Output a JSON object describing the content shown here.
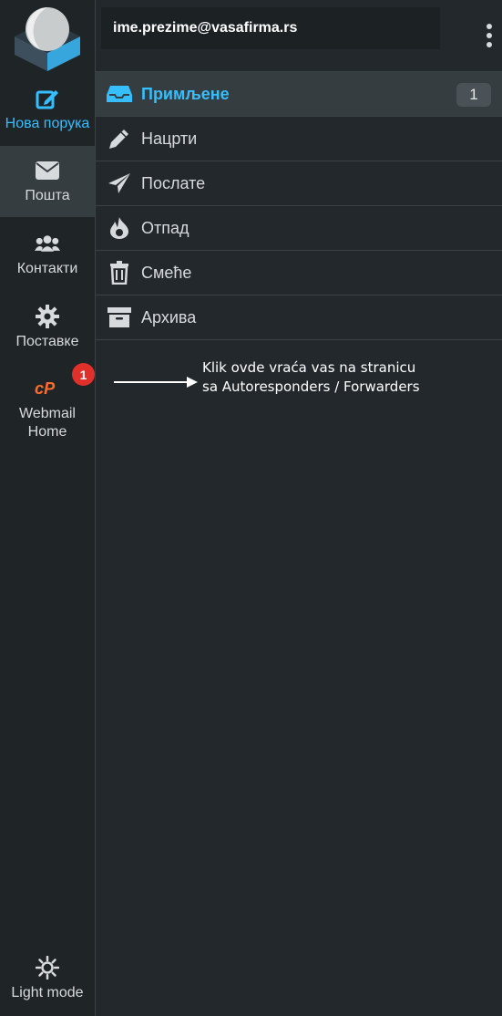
{
  "account": {
    "email": "ime.prezime@vasafirma.rs"
  },
  "nav": {
    "compose": "Нова порука",
    "mail": "Пошта",
    "contacts": "Контакти",
    "settings": "Поставке",
    "webmail_line1": "Webmail",
    "webmail_line2": "Home",
    "light_mode": "Light mode",
    "badge": "1"
  },
  "folders": [
    {
      "label": "Примљене",
      "icon": "inbox-icon",
      "count": "1",
      "active": true
    },
    {
      "label": "Нацрти",
      "icon": "pencil-icon"
    },
    {
      "label": "Послате",
      "icon": "paper-plane-icon"
    },
    {
      "label": "Отпад",
      "icon": "fire-icon"
    },
    {
      "label": "Смеће",
      "icon": "trash-icon"
    },
    {
      "label": "Архива",
      "icon": "archive-icon"
    }
  ],
  "annotation": {
    "line1": "Klik ovde vraća vas na stranicu",
    "line2": "sa Autoresponders / Forwarders"
  },
  "colors": {
    "accent": "#37beff",
    "cpanel": "#ff6c2c",
    "badge_red": "#e0302a",
    "background": "#22282c"
  }
}
